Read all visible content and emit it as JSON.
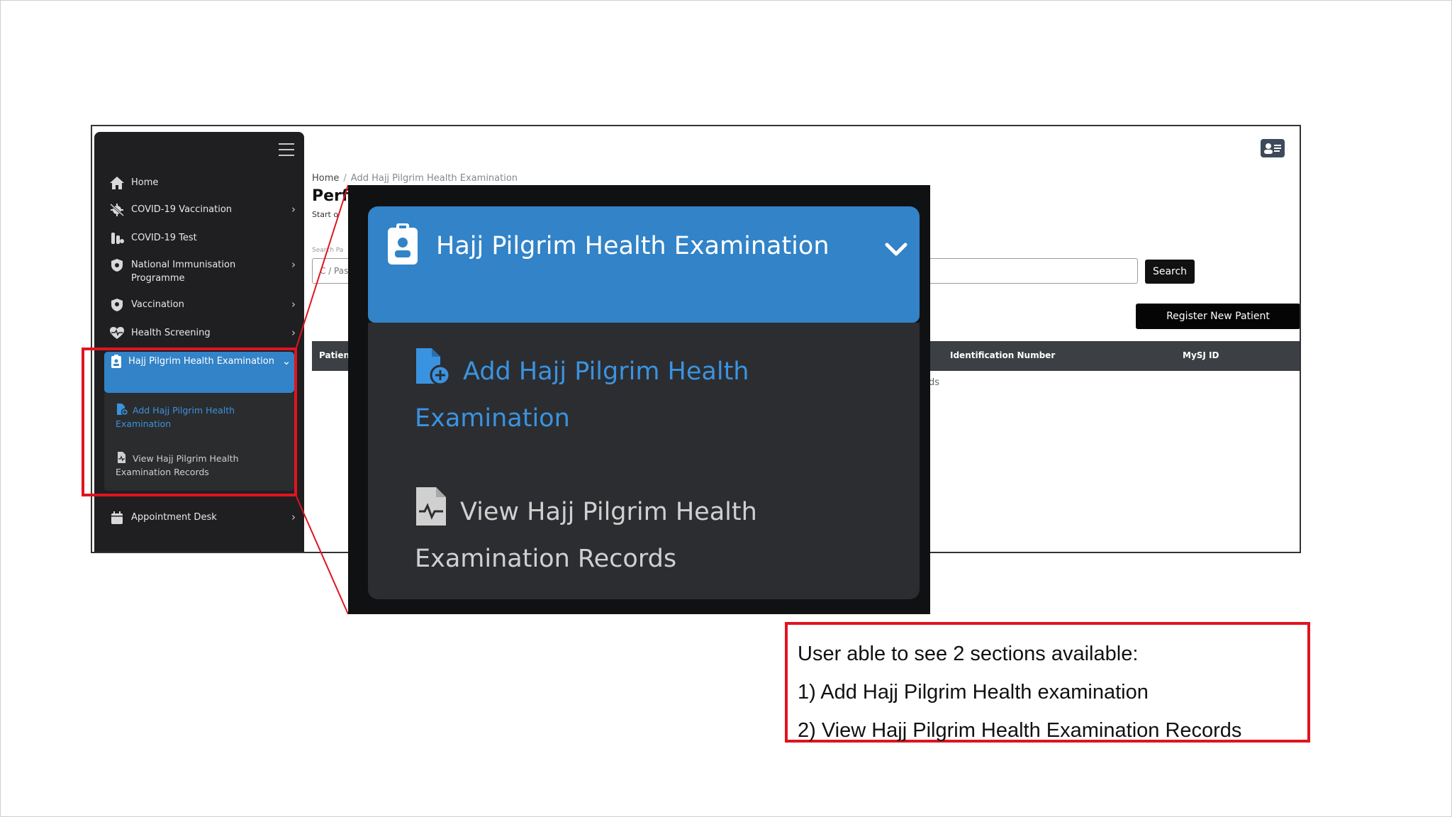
{
  "sidebar": {
    "items": [
      {
        "label": "Home",
        "icon": "home-icon",
        "has_chevron": false
      },
      {
        "label": "COVID-19 Vaccination",
        "icon": "virus-slash-icon",
        "has_chevron": true
      },
      {
        "label": "COVID-19 Test",
        "icon": "vials-icon",
        "has_chevron": false
      },
      {
        "label": "National Immunisation Programme",
        "icon": "shield-virus-icon",
        "has_chevron": true
      },
      {
        "label": "Vaccination",
        "icon": "shield-icon",
        "has_chevron": true
      },
      {
        "label": "Health Screening",
        "icon": "heartbeat-icon",
        "has_chevron": true
      },
      {
        "label": "Hajj Pilgrim Health Examination",
        "icon": "id-badge-icon",
        "has_chevron": true,
        "active": true
      },
      {
        "label": "Appointment Desk",
        "icon": "calendar-icon",
        "has_chevron": true
      }
    ],
    "sub_items": [
      {
        "label": "Add Hajj Pilgrim Health Examination",
        "icon": "file-plus-icon",
        "color": "#3a93e0"
      },
      {
        "label": "View Hajj Pilgrim Health Examination Records",
        "icon": "file-medical-icon",
        "color": "#cfcfcf"
      }
    ]
  },
  "main": {
    "breadcrumb": {
      "home": "Home",
      "separator": "/",
      "current": "Add Hajj Pilgrim Health Examination"
    },
    "title": "Perf",
    "subtitle": "Start o",
    "search_label": "Search Pa",
    "search_placeholder": "C / Pas",
    "search_button": "Search",
    "register_button": "Register New Patient",
    "table_headers": [
      "Patient",
      "Identification Number",
      "MySJ ID"
    ],
    "no_records_fragment": "ds"
  },
  "zoom": {
    "header_title": "Hajj Pilgrim Health Examination",
    "items": [
      {
        "label": "Add Hajj Pilgrim Health Examination",
        "color": "#3a93e0"
      },
      {
        "label": "View Hajj Pilgrim Health Examination Records",
        "color": "#d0d0d0"
      }
    ]
  },
  "note": {
    "line1": "User able to see  2 sections available:",
    "line2": "1) Add Hajj Pilgrim Health examination",
    "line3": "2) View Hajj Pilgrim Health Examination Records"
  },
  "colors": {
    "accent": "#3283c8",
    "highlight_red": "#e0141f",
    "sidebar_bg": "#1f1f21"
  }
}
